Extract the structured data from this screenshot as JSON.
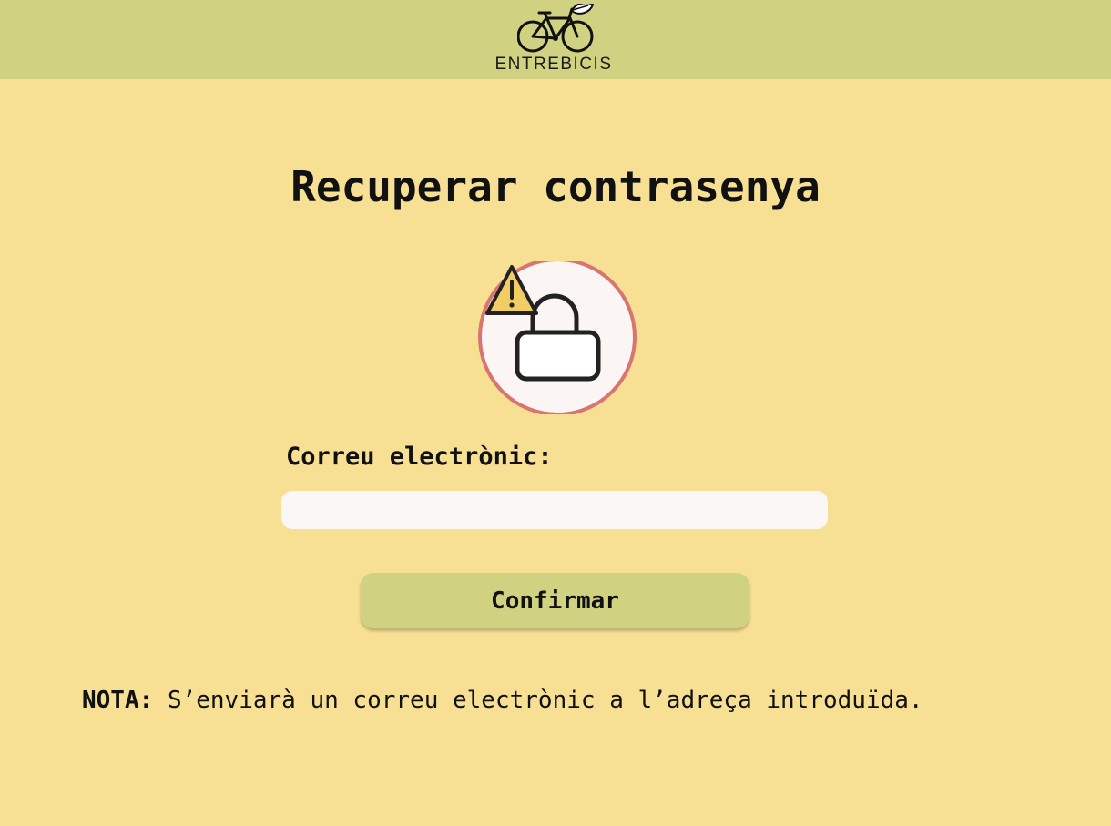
{
  "header": {
    "logo_text": "ENTREBICIS",
    "logo_icon": "bicycle-leaf-icon",
    "background_color": "#d1d281"
  },
  "page": {
    "title": "Recuperar contrasenya",
    "background_color": "#f7e093"
  },
  "illustration": {
    "icon": "locked-padlock-warning-icon",
    "circle_border_color": "#d97570",
    "warning_color": "#f0ce64"
  },
  "form": {
    "email_label": "Correu electrònic:",
    "email_value": "",
    "email_placeholder": "",
    "confirm_label": "Confirmar",
    "button_color": "#d1d281"
  },
  "note": {
    "label": "NOTA:",
    "text": "S’enviarà un correu electrònic a l’adreça introduïda."
  }
}
